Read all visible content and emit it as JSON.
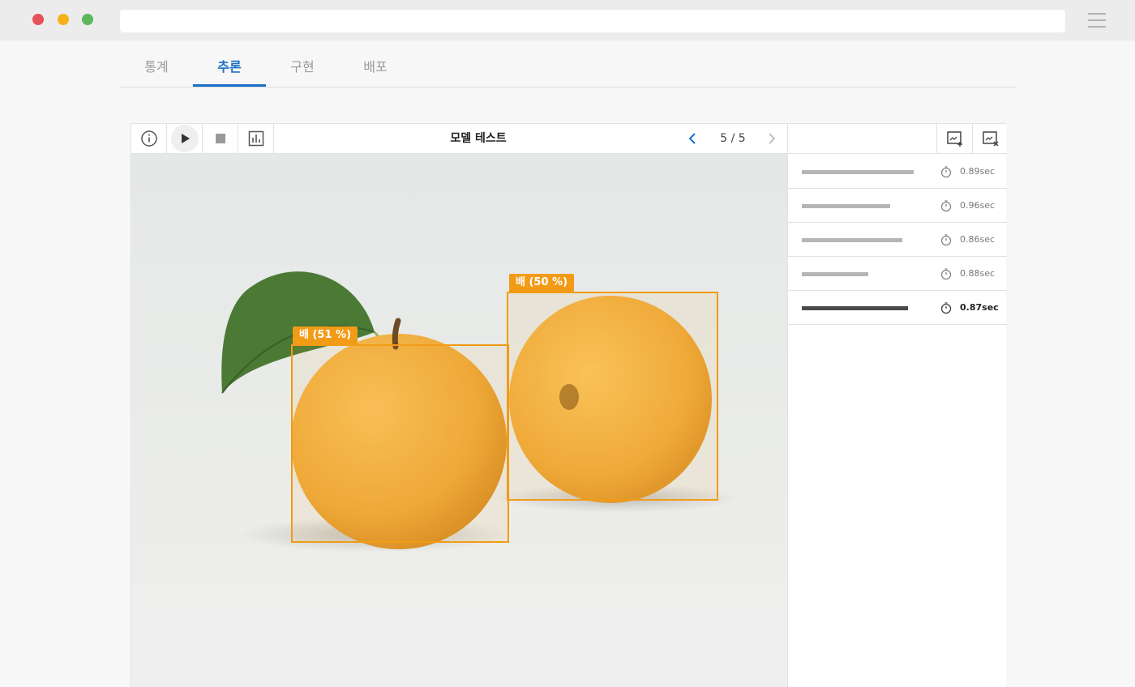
{
  "tabs": [
    {
      "label": "통계",
      "active": false
    },
    {
      "label": "추론",
      "active": true
    },
    {
      "label": "구현",
      "active": false
    },
    {
      "label": "배포",
      "active": false
    }
  ],
  "toolbar": {
    "title": "모델 테스트",
    "pager": "5 / 5",
    "icons": [
      "info-icon",
      "play-icon",
      "stop-icon",
      "chart-icon",
      "chevron-left-icon",
      "chevron-right-icon"
    ]
  },
  "detections": [
    {
      "label": "배 (51 %)"
    },
    {
      "label": "배 (50 %)"
    }
  ],
  "side": {
    "icons": [
      "image-add-icon",
      "image-remove-icon"
    ],
    "results": [
      {
        "time": "0.89sec",
        "bar_fraction": 0.81,
        "active": false
      },
      {
        "time": "0.96sec",
        "bar_fraction": 0.64,
        "active": false
      },
      {
        "time": "0.86sec",
        "bar_fraction": 0.73,
        "active": false
      },
      {
        "time": "0.88sec",
        "bar_fraction": 0.48,
        "active": false
      },
      {
        "time": "0.87sec",
        "bar_fraction": 0.77,
        "active": true
      }
    ]
  },
  "colors": {
    "accent": "#1a6fc8",
    "bbox": "#f29b16"
  }
}
